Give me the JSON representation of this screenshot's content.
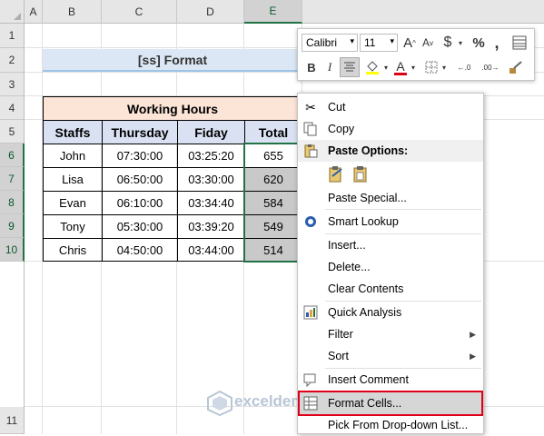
{
  "columns": [
    "A",
    "B",
    "C",
    "D",
    "E"
  ],
  "rows": [
    "1",
    "2",
    "3",
    "4",
    "5",
    "6",
    "7",
    "8",
    "9",
    "10",
    "11"
  ],
  "title": "[ss] Format",
  "table": {
    "group_header": "Working Hours",
    "headers": [
      "Staffs",
      "Thursday",
      "Fiday",
      "Total"
    ],
    "data": [
      [
        "John",
        "07:30:00",
        "03:25:20",
        "655"
      ],
      [
        "Lisa",
        "06:50:00",
        "03:30:00",
        "620"
      ],
      [
        "Evan",
        "06:10:00",
        "03:34:40",
        "584"
      ],
      [
        "Tony",
        "05:30:00",
        "03:39:20",
        "549"
      ],
      [
        "Chris",
        "04:50:00",
        "03:44:00",
        "514"
      ]
    ]
  },
  "mini_toolbar": {
    "font_name": "Calibri",
    "font_size": "11",
    "bold": "B",
    "italic": "I",
    "currency": "$",
    "percent": "%",
    "comma": ",",
    "grow_font": "A",
    "shrink_font": "A",
    "font_color": "A",
    "inc_decimal": "←.0",
    "dec_decimal": ".00→"
  },
  "context_menu": {
    "cut": "Cut",
    "copy": "Copy",
    "paste_options": "Paste Options:",
    "paste_special": "Paste Special...",
    "smart_lookup": "Smart Lookup",
    "insert": "Insert...",
    "delete": "Delete...",
    "clear_contents": "Clear Contents",
    "quick_analysis": "Quick Analysis",
    "filter": "Filter",
    "sort": "Sort",
    "insert_comment": "Insert Comment",
    "format_cells": "Format Cells...",
    "pick_dropdown": "Pick From Drop-down List..."
  },
  "watermark": "exceldemy",
  "colors": {
    "accent": "#217346",
    "highlight": "#e0001a",
    "header_fill": "#d9e1f2",
    "group_fill": "#fce4d6"
  }
}
